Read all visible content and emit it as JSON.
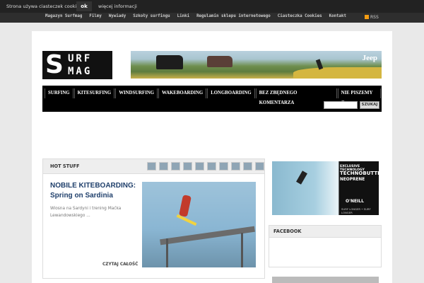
{
  "cookie_bar": {
    "message": "Strona używa ciasteczek cookies",
    "ok_label": "ok",
    "more_label": "więcej informacji"
  },
  "top_nav": {
    "links": [
      "Magazyn Surfmag",
      "Filmy",
      "Wywiady",
      "Szkoły surfingu",
      "Linki",
      "Regulamin sklepu internetowego",
      "Ciasteczka Cookies",
      "Kontakt"
    ],
    "rss_label": "RSS"
  },
  "logo": {
    "line1": "URF",
    "line2": "MAG",
    "initial": "S"
  },
  "banner": {
    "brand": "Jeep"
  },
  "main_nav": {
    "items": [
      "SURFING",
      "KITESURFING",
      "WINDSURFING",
      "WAKEBOARDING",
      "LONGBOARDING",
      "BEZ ZBĘDNEGO KOMENTARZA",
      "NIE PISZEMY O"
    ],
    "search_button": "SZUKAJ"
  },
  "hot_stuff": {
    "heading": "HOT STUFF",
    "article_title_line1": "NOBILE KITEBOARDING:",
    "article_title_line2": "Spring on Sardinia",
    "excerpt": "Wiosna na Sardyni i trening Maćka Lewandowskiego ...",
    "read_more": "CZYTAJ CAŁOŚĆ"
  },
  "side_ad": {
    "line1": "EXCLUSIVE TECHNOLOGY",
    "line2": "TECHNOBUTTER",
    "line3": "NEOPRENE",
    "brand": "O'NEILL",
    "tagline": "SURF LONGER • SURF LONGER"
  },
  "facebook": {
    "heading": "FACEBOOK"
  }
}
